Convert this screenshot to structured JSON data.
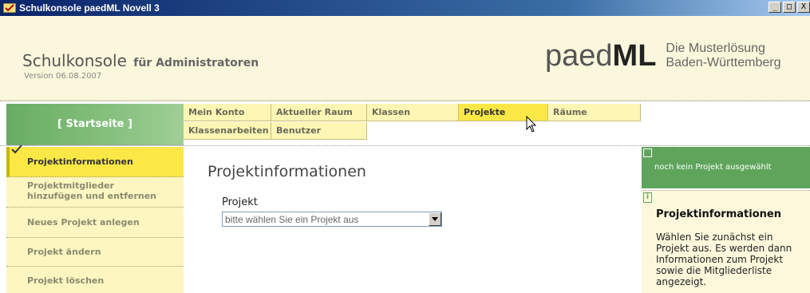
{
  "window": {
    "title": "Schulkonsole paedML Novell 3",
    "controls": [
      "_",
      "□",
      "X"
    ]
  },
  "header": {
    "title": "Schulkonsole",
    "subtitle": "für Administratoren",
    "version": "Version 06.08.2007",
    "logo": {
      "paed": "paed",
      "ml": "ML",
      "tagline_line1": "Die Musterlösung",
      "tagline_line2": "Baden-Württemberg"
    }
  },
  "start": {
    "label": "[ Startseite ]"
  },
  "topnav": {
    "row1": [
      "Mein Konto",
      "Aktueller Raum",
      "Klassen",
      "Projekte",
      "Räume"
    ],
    "row2": [
      "Klassenarbeiten",
      "Benutzer"
    ],
    "active": "Projekte"
  },
  "sidebar": {
    "items": [
      {
        "label": "Projektinformationen",
        "active": true
      },
      {
        "label": "Projektmitglieder hinzufügen und entfernen",
        "active": false
      },
      {
        "label": "Neues Projekt anlegen",
        "active": false
      },
      {
        "label": "Projekt ändern",
        "active": false
      },
      {
        "label": "Projekt löschen",
        "active": false
      }
    ]
  },
  "main": {
    "heading": "Projektinformationen",
    "field_label": "Projekt",
    "select_value": "bitte wählen Sie ein Projekt aus"
  },
  "status": {
    "text": "noch kein Projekt ausgewählt"
  },
  "info": {
    "icon": "i",
    "title": "Projektinformationen",
    "text": "Wählen Sie zunächst ein Projekt aus. Es werden dann Informationen zum Projekt sowie die Mitgliederliste angezeigt."
  },
  "colors": {
    "title_bar": "#0a246a",
    "header_bg": "#fbf7dc",
    "nav_bg": "#fdf6b4",
    "nav_active": "#fbe846",
    "green": "#5ea55b"
  },
  "icons": {
    "app": "paedml-check-icon",
    "status": "checkbox-icon",
    "info": "info-icon",
    "select": "chevron-down-icon"
  }
}
